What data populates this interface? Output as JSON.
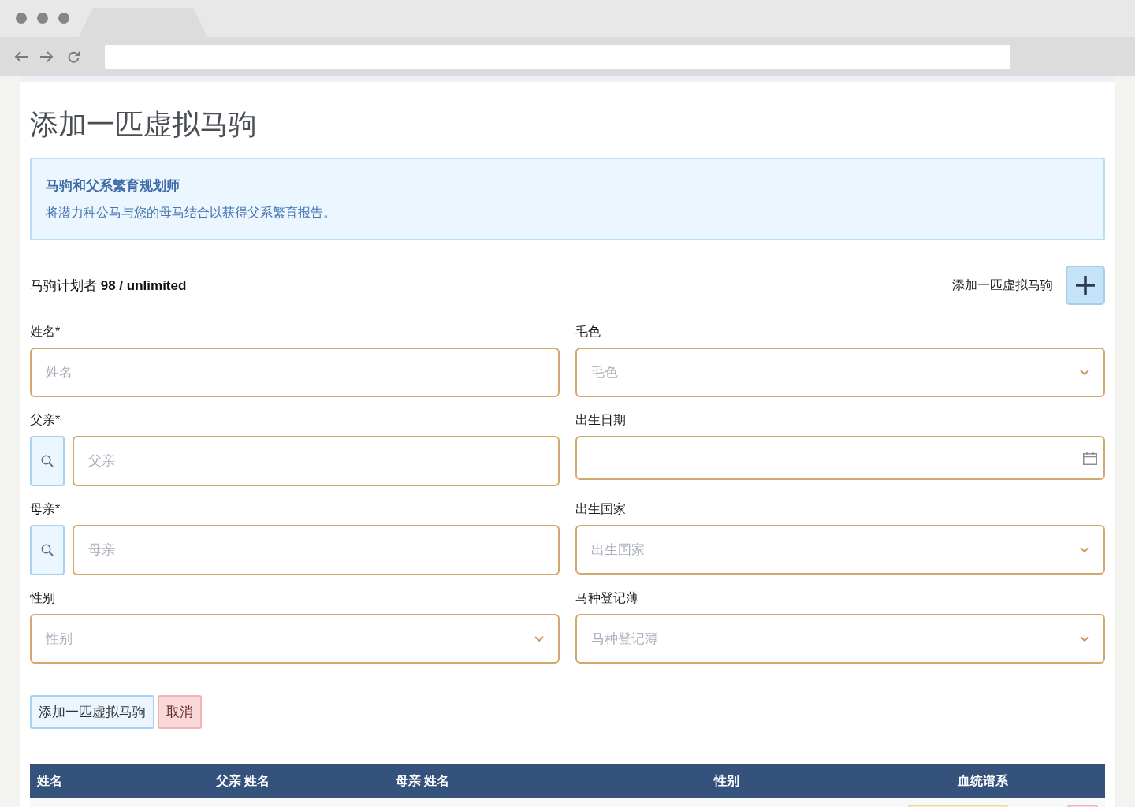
{
  "page": {
    "title": "添加一匹虚拟马驹"
  },
  "info_box": {
    "title": "马驹和父系繁育规划师",
    "text": "将潜力种公马与您的母马结合以获得父系繁育报告。"
  },
  "planner": {
    "usage": "马驹计划者 **98 / unlimited**",
    "add_label": "添加一匹虚拟马驹"
  },
  "form": {
    "fields": [
      {
        "kind": "text",
        "label": "姓名*",
        "placeholder": "姓名"
      },
      {
        "kind": "select",
        "label": "毛色",
        "placeholder": "毛色"
      },
      {
        "kind": "search",
        "label": "父亲*",
        "placeholder": "父亲"
      },
      {
        "kind": "date",
        "label": "出生日期"
      },
      {
        "kind": "search",
        "label": "母亲*",
        "placeholder": "母亲"
      },
      {
        "kind": "select",
        "label": "出生国家",
        "placeholder": "出生国家"
      },
      {
        "kind": "select",
        "label": "性别",
        "placeholder": "性别"
      },
      {
        "kind": "select",
        "label": "马种登记薄",
        "placeholder": "马种登记薄"
      }
    ],
    "buttons": [
      {
        "kind": "primary",
        "label": "添加一匹虚拟马驹"
      },
      {
        "kind": "danger",
        "label": "取消"
      }
    ]
  },
  "table": {
    "columns": [
      "姓名",
      "父亲 姓名",
      "母亲 姓名",
      "性别",
      "血统谱系"
    ],
    "rows": [
      {
        "actions": [
          {
            "kind": "warning"
          },
          {
            "kind": "danger"
          }
        ]
      }
    ]
  }
}
